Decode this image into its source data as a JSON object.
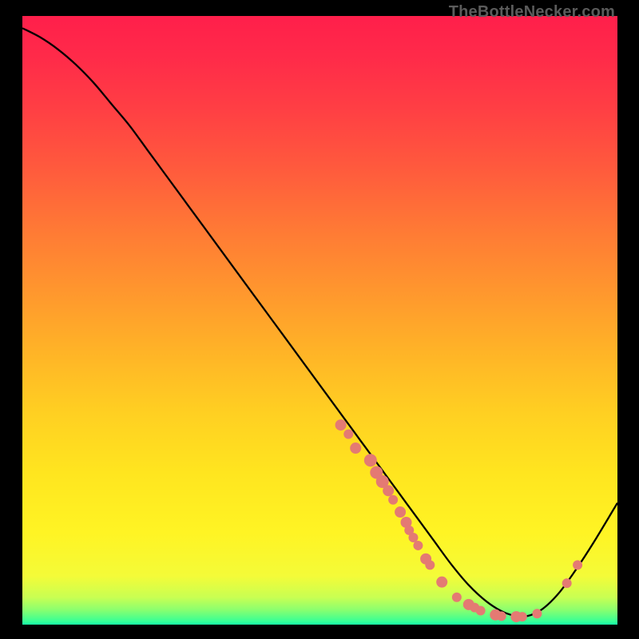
{
  "watermark": "TheBottleNecker.com",
  "chart_data": {
    "type": "line",
    "title": "",
    "xlabel": "",
    "ylabel": "",
    "xlim": [
      0,
      100
    ],
    "ylim": [
      0,
      100
    ],
    "series": [
      {
        "name": "curve",
        "x": [
          0,
          3,
          6,
          9,
          12,
          15,
          18,
          21,
          24,
          27,
          30,
          33,
          36,
          39,
          42,
          45,
          48,
          51,
          54,
          57,
          60,
          63,
          66,
          69,
          72,
          75,
          78,
          81,
          84,
          87,
          90,
          93,
          96,
          100
        ],
        "y": [
          98,
          96.5,
          94.5,
          92,
          89,
          85.5,
          82,
          78,
          74,
          70,
          66,
          62,
          58,
          54,
          50,
          46,
          42,
          38,
          34,
          30,
          26,
          22,
          18,
          14,
          10,
          6.5,
          3.8,
          2,
          1.3,
          2.3,
          5,
          9,
          13.5,
          20
        ]
      }
    ],
    "points": [
      {
        "x": 53.5,
        "y": 32.8,
        "r": 7
      },
      {
        "x": 54.8,
        "y": 31.3,
        "r": 6
      },
      {
        "x": 56.0,
        "y": 29.0,
        "r": 7
      },
      {
        "x": 58.5,
        "y": 27.0,
        "r": 8
      },
      {
        "x": 59.5,
        "y": 25.0,
        "r": 8
      },
      {
        "x": 60.5,
        "y": 23.5,
        "r": 8
      },
      {
        "x": 61.5,
        "y": 22.0,
        "r": 7
      },
      {
        "x": 62.3,
        "y": 20.5,
        "r": 6
      },
      {
        "x": 63.5,
        "y": 18.5,
        "r": 7
      },
      {
        "x": 64.5,
        "y": 16.8,
        "r": 7
      },
      {
        "x": 65.0,
        "y": 15.5,
        "r": 6
      },
      {
        "x": 65.7,
        "y": 14.3,
        "r": 6
      },
      {
        "x": 66.5,
        "y": 13.0,
        "r": 6
      },
      {
        "x": 67.8,
        "y": 10.8,
        "r": 7
      },
      {
        "x": 68.5,
        "y": 9.8,
        "r": 6
      },
      {
        "x": 70.5,
        "y": 7.0,
        "r": 7
      },
      {
        "x": 73.0,
        "y": 4.5,
        "r": 6
      },
      {
        "x": 75.0,
        "y": 3.3,
        "r": 7
      },
      {
        "x": 76.0,
        "y": 2.8,
        "r": 6
      },
      {
        "x": 77.0,
        "y": 2.3,
        "r": 6
      },
      {
        "x": 79.5,
        "y": 1.6,
        "r": 7
      },
      {
        "x": 80.5,
        "y": 1.4,
        "r": 6
      },
      {
        "x": 83.0,
        "y": 1.3,
        "r": 7
      },
      {
        "x": 84.0,
        "y": 1.3,
        "r": 6
      },
      {
        "x": 86.5,
        "y": 1.8,
        "r": 6
      },
      {
        "x": 91.5,
        "y": 6.8,
        "r": 6
      },
      {
        "x": 93.3,
        "y": 9.8,
        "r": 6
      }
    ],
    "gradient": {
      "stops": [
        {
          "offset": 0.0,
          "color": "#ff1f4b"
        },
        {
          "offset": 0.07,
          "color": "#ff2b49"
        },
        {
          "offset": 0.15,
          "color": "#ff3e44"
        },
        {
          "offset": 0.25,
          "color": "#ff5a3d"
        },
        {
          "offset": 0.35,
          "color": "#ff7935"
        },
        {
          "offset": 0.45,
          "color": "#ff962e"
        },
        {
          "offset": 0.55,
          "color": "#ffb327"
        },
        {
          "offset": 0.65,
          "color": "#ffcf22"
        },
        {
          "offset": 0.75,
          "color": "#ffe51f"
        },
        {
          "offset": 0.85,
          "color": "#fff424"
        },
        {
          "offset": 0.92,
          "color": "#f4fb38"
        },
        {
          "offset": 0.955,
          "color": "#c9ff52"
        },
        {
          "offset": 0.975,
          "color": "#8dff6e"
        },
        {
          "offset": 0.99,
          "color": "#4cff8c"
        },
        {
          "offset": 1.0,
          "color": "#18ffa7"
        }
      ]
    },
    "point_color": "#e47a73",
    "line_color": "#000000"
  }
}
